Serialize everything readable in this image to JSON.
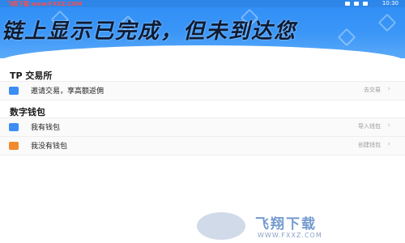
{
  "status_bar": {
    "left_text": "飞翔下载 www.FXXZ.COM",
    "time": "10:30"
  },
  "banner": {
    "title": "链上显示已完成，但未到达您"
  },
  "exchange_section": {
    "title": "TP 交易所",
    "row": {
      "label": "邀请交易，享高额返佣",
      "action": "去交易",
      "icon": "exchange-icon"
    }
  },
  "wallet_section": {
    "title": "数字钱包",
    "rows": [
      {
        "label": "我有钱包",
        "action": "导入钱包",
        "icon": "wallet-icon",
        "color": "#3a8ef6"
      },
      {
        "label": "我没有钱包",
        "action": "创建钱包",
        "icon": "create-wallet-icon",
        "color": "#f08a2c"
      }
    ]
  },
  "watermark": {
    "brand": "飞翔下载",
    "url": "WWW.FXXZ.COM"
  },
  "colors": {
    "primary": "#2f8df5"
  }
}
